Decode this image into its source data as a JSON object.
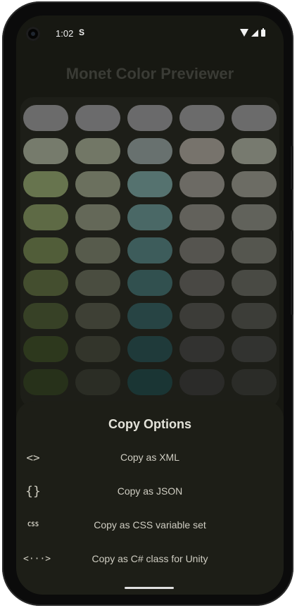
{
  "status": {
    "time": "1:02",
    "extra_icon": "S"
  },
  "app": {
    "title": "Monet Color Previewer"
  },
  "palette_rows": [
    [
      "#6b6b6b",
      "#6b6b6c",
      "#6a6a6b",
      "#6b6b6b",
      "#6b6b6b"
    ],
    [
      "#767b6c",
      "#727766",
      "#68716f",
      "#77736c",
      "#777a6f"
    ],
    [
      "#67744e",
      "#6b705e",
      "#55726f",
      "#6c6a64",
      "#6c6c64"
    ],
    [
      "#5e6a45",
      "#646858",
      "#4a6866",
      "#62615b",
      "#61625b"
    ],
    [
      "#515d39",
      "#575b4c",
      "#3d5c5b",
      "#55544f",
      "#55564f"
    ],
    [
      "#444e2f",
      "#4a4d40",
      "#31504f",
      "#494844",
      "#494a44"
    ],
    [
      "#374126",
      "#3e4035",
      "#274444",
      "#3c3c38",
      "#3c3d38"
    ],
    [
      "#2d381d",
      "#33352b",
      "#1f3a3a",
      "#323230",
      "#323330"
    ],
    [
      "#27311a",
      "#2b2d25",
      "#1a3534",
      "#2b2b29",
      "#2b2c28"
    ]
  ],
  "sheet": {
    "title": "Copy Options",
    "options": [
      {
        "icon": "code-brackets-icon",
        "glyph": "<>",
        "label": "Copy as XML"
      },
      {
        "icon": "curly-braces-icon",
        "glyph": "{}",
        "label": "Copy as JSON"
      },
      {
        "icon": "css-icon",
        "glyph": "CSS",
        "label": "Copy as CSS variable set"
      },
      {
        "icon": "code-dots-icon",
        "glyph": "<···>",
        "label": "Copy as C# class for Unity"
      }
    ]
  }
}
